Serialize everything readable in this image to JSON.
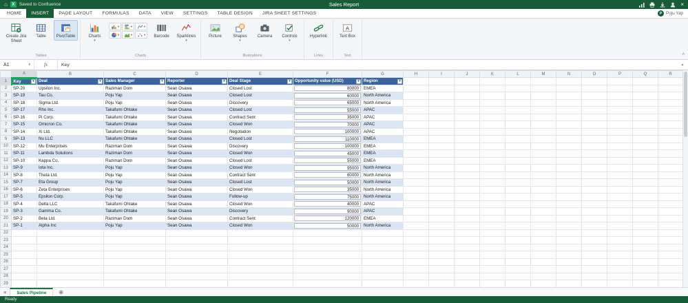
{
  "titlebar": {
    "saved_text": "Saved to Confluence",
    "title": "Sales Report",
    "app_initial": "X"
  },
  "user": {
    "name": "Poju Yap",
    "initial": "P"
  },
  "ribbon_tabs": [
    "HOME",
    "INSERT",
    "PAGE LAYOUT",
    "FORMULAS",
    "DATA",
    "VIEW",
    "SETTINGS",
    "TABLE DESIGN",
    "JIRA SHEET SETTINGS"
  ],
  "active_tab": "INSERT",
  "ribbon": {
    "tables_group": {
      "label": "Tables",
      "create_jira_sheet": "Create Jira Sheet",
      "table": "Table",
      "pivottable": "PivotTable"
    },
    "charts_group": {
      "label": "Charts",
      "charts": "Charts",
      "barcode": "Barcode",
      "sparklines": "Sparklines",
      "mini_buttons": [
        "column-chart",
        "bar-chart",
        "line-chart",
        "pie-chart",
        "area-chart",
        "scatter-chart"
      ]
    },
    "illustrations_group": {
      "label": "Illustrations",
      "picture": "Picture",
      "shapes": "Shapes",
      "camera": "Camera",
      "controls": "Controls"
    },
    "links_group": {
      "label": "Links",
      "hyperlink": "Hyperlink"
    },
    "text_group": {
      "label": "Text",
      "textbox": "Text Box"
    }
  },
  "formula_bar": {
    "cell_ref": "A1",
    "value": "Key"
  },
  "grid": {
    "column_letters": [
      "A",
      "B",
      "C",
      "D",
      "E",
      "F",
      "G",
      "H",
      "I",
      "J",
      "K",
      "L",
      "M",
      "N",
      "O",
      "P",
      "Q",
      "R"
    ],
    "headers": [
      "Key",
      "Deal",
      "Sales Manager",
      "Reporter",
      "Deal Stage",
      "Opportunity value (USD)",
      "Region"
    ],
    "selected_cell": "A1",
    "rows": [
      [
        "SP-20",
        "Upsilon Inc.",
        "Raziman Dom",
        "Sean Osawa",
        "Closed Lost",
        "80000",
        "EMEA"
      ],
      [
        "SP-19",
        "Tau Co.",
        "Poju Yap",
        "Sean Osawa",
        "Closed Lost",
        "60000",
        "North America"
      ],
      [
        "SP-18",
        "Sigma Ltd.",
        "Poju Yap",
        "Sean Osawa",
        "Discovery",
        "65000",
        "North America"
      ],
      [
        "SP-17",
        "Rho Inc.",
        "Takafumi Ohtake",
        "Sean Osawa",
        "Closed Lost",
        "55000",
        "APAC"
      ],
      [
        "SP-16",
        "Pi Corp.",
        "Takafumi Ohtake",
        "Sean Osawa",
        "Contract Sent",
        "35000",
        "APAC"
      ],
      [
        "SP-15",
        "Omicron Co.",
        "Takafumi Ohtake",
        "Sean Osawa",
        "Closed Won",
        "70000",
        "APAC"
      ],
      [
        "SP-14",
        "Xi Ltd.",
        "Takafumi Ohtake",
        "Sean Osawa",
        "Negotiation",
        "100000",
        "APAC"
      ],
      [
        "SP-13",
        "Nu LLC",
        "Takafumi Ohtake",
        "Sean Osawa",
        "Closed Lost",
        "110000",
        "EMEA"
      ],
      [
        "SP-12",
        "Mu Enterprises",
        "Raziman Dom",
        "Sean Osawa",
        "Discovery",
        "100000",
        "EMEA"
      ],
      [
        "SP-11",
        "Lambda Solutions",
        "Raziman Dom",
        "Sean Osawa",
        "Closed Won",
        "45000",
        "EMEA"
      ],
      [
        "SP-10",
        "Kappa Co.",
        "Raziman Dom",
        "Sean Osawa",
        "Closed Lost",
        "55000",
        "EMEA"
      ],
      [
        "SP-9",
        "Iota Inc.",
        "Poju Yap",
        "Sean Osawa",
        "Closed Won",
        "95000",
        "North America"
      ],
      [
        "SP-8",
        "Theta Ltd.",
        "Poju Yap",
        "Sean Osawa",
        "Contract Sent",
        "60000",
        "North America"
      ],
      [
        "SP-7",
        "Eta Group",
        "Poju Yap",
        "Sean Osawa",
        "Closed Lost",
        "50000",
        "North America"
      ],
      [
        "SP-6",
        "Zeta Enterprises",
        "Poju Yap",
        "Sean Osawa",
        "Closed Won",
        "35000",
        "North America"
      ],
      [
        "SP-5",
        "Epsilon Corp.",
        "Poju Yap",
        "Sean Osawa",
        "Follow-up",
        "75000",
        "North America"
      ],
      [
        "SP-4",
        "Delta LLC",
        "Takafumi Ohtake",
        "Sean Osawa",
        "Closed Won",
        "40000",
        "APAC"
      ],
      [
        "SP-3",
        "Gamma Co.",
        "Takafumi Ohtake",
        "Sean Osawa",
        "Discovery",
        "90000",
        "APAC"
      ],
      [
        "SP-2",
        "Beta Ltd.",
        "Raziman Dom",
        "Sean Osawa",
        "Contract Sent",
        "120000",
        "EMEA"
      ],
      [
        "SP-1",
        "Alpha Inc",
        "Poju Yap",
        "Sean Osawa",
        "Closed Won",
        "50000",
        "North America"
      ]
    ],
    "empty_rows_to": 29
  },
  "sheet_tabs": {
    "active": "Sales Pipeline",
    "add_label": "⊕",
    "menu_icon": "≡"
  },
  "status_bar": {
    "text": "Ready"
  },
  "colors": {
    "brand_green": "#185c37",
    "header_blue": "#3c649c",
    "band_blue": "#dbe5f2",
    "selection_green": "#21a05f"
  }
}
